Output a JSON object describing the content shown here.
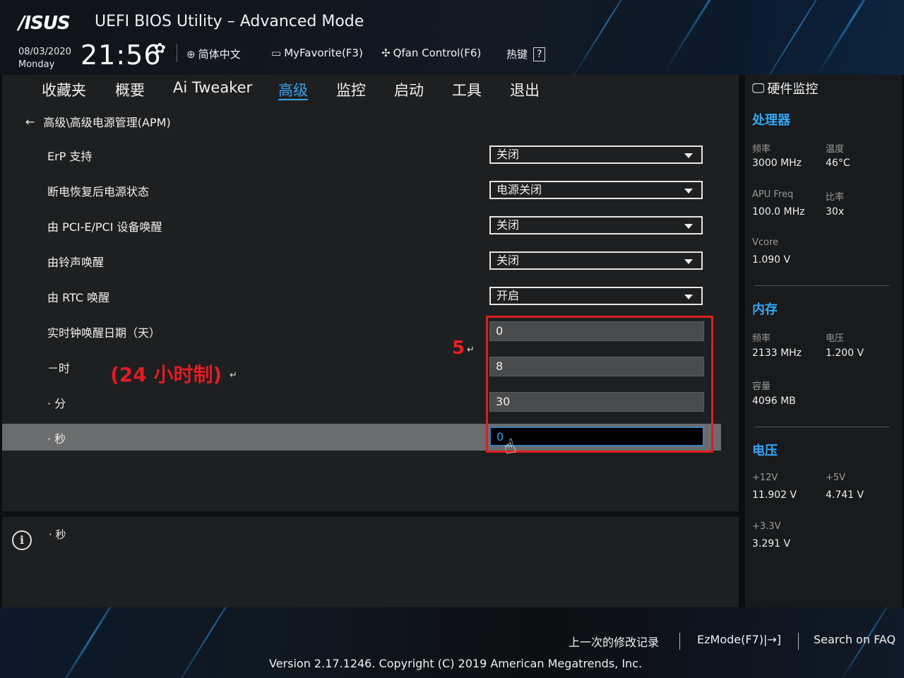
{
  "header": {
    "logo": "/ISUS",
    "title": "UEFI BIOS Utility – Advanced Mode",
    "date": "08/03/2020",
    "weekday": "Monday",
    "time": "21:56",
    "language": "简体中文",
    "myfavorite": "MyFavorite(F3)",
    "qfan": "Qfan Control(F6)",
    "hotkey": "热键",
    "hotkey_key": "?"
  },
  "tabs": [
    {
      "label": "收藏夹"
    },
    {
      "label": "概要"
    },
    {
      "label": "Ai Tweaker"
    },
    {
      "label": "高级",
      "active": true
    },
    {
      "label": "监控"
    },
    {
      "label": "启动"
    },
    {
      "label": "工具"
    },
    {
      "label": "退出"
    }
  ],
  "breadcrumb": "高级\\高级电源管理(APM)",
  "settings": [
    {
      "label": "ErP 支持",
      "value": "关闭",
      "type": "select"
    },
    {
      "label": "断电恢复后电源状态",
      "value": "电源关闭",
      "type": "select"
    },
    {
      "label": "由 PCI-E/PCI 设备唤醒",
      "value": "关闭",
      "type": "select"
    },
    {
      "label": "由铃声唤醒",
      "value": "关闭",
      "type": "select"
    },
    {
      "label": "由 RTC 唤醒",
      "value": "开启",
      "type": "select"
    },
    {
      "label": "实时钟唤醒日期（天）",
      "value": "0",
      "type": "field"
    },
    {
      "label": "－时",
      "value": "8",
      "type": "field"
    },
    {
      "label": "· 分",
      "value": "30",
      "type": "field"
    },
    {
      "label": "· 秒",
      "value": "0",
      "type": "field"
    }
  ],
  "annotations": {
    "step": "5",
    "hour_note": "(24 小时制)",
    "return_mark": "↵"
  },
  "help_text": "· 秒",
  "monitor": {
    "title": "硬件监控",
    "cpu": {
      "heading": "处理器",
      "freq_label": "频率",
      "freq": "3000 MHz",
      "temp_label": "温度",
      "temp": "46°C",
      "apu_label": "APU Freq",
      "apu": "100.0 MHz",
      "ratio_label": "比率",
      "ratio": "30x",
      "vcore_label": "Vcore",
      "vcore": "1.090 V"
    },
    "memory": {
      "heading": "内存",
      "freq_label": "频率",
      "freq": "2133 MHz",
      "volt_label": "电压",
      "volt": "1.200 V",
      "cap_label": "容量",
      "cap": "4096 MB"
    },
    "voltage": {
      "heading": "电压",
      "v12_label": "+12V",
      "v12": "11.902 V",
      "v5_label": "+5V",
      "v5": "4.741 V",
      "v33_label": "+3.3V",
      "v33": "3.291 V"
    }
  },
  "footer": {
    "last_changes": "上一次的修改记录",
    "ezmode": "EzMode(F7)|→]",
    "faq": "Search on FAQ",
    "version": "Version 2.17.1246. Copyright (C) 2019 American Megatrends, Inc."
  },
  "colors": {
    "accent": "#35a6f4",
    "highlight_box": "#e01c24",
    "selected_row": "#6b6c6d"
  }
}
